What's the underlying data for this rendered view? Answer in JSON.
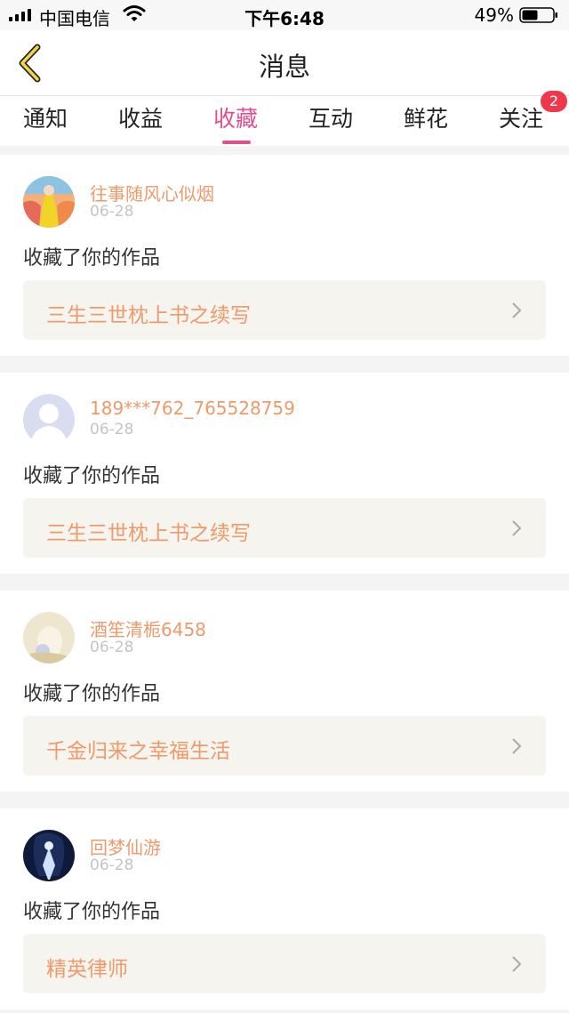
{
  "status": {
    "carrier": "中国电信",
    "time": "下午6:48",
    "battery": "49%"
  },
  "header": {
    "title": "消息"
  },
  "tabs": [
    {
      "label": "通知"
    },
    {
      "label": "收益"
    },
    {
      "label": "收藏",
      "active": true
    },
    {
      "label": "互动"
    },
    {
      "label": "鲜花"
    },
    {
      "label": "关注"
    }
  ],
  "badge_count": "2",
  "colors": {
    "accent": "#e0508f",
    "name": "#ee9a6b",
    "badge": "#f0384c"
  },
  "messages": [
    {
      "user": "往事随风心似烟",
      "date": "06-28",
      "action": "收藏了你的作品",
      "work": "三生三世枕上书之续写"
    },
    {
      "user": "189***762_765528759",
      "date": "06-28",
      "action": "收藏了你的作品",
      "work": "三生三世枕上书之续写"
    },
    {
      "user": "酒笙清栀6458",
      "date": "06-28",
      "action": "收藏了你的作品",
      "work": "千金归来之幸福生活"
    },
    {
      "user": "回梦仙游",
      "date": "06-28",
      "action": "收藏了你的作品",
      "work": "精英律师"
    }
  ]
}
